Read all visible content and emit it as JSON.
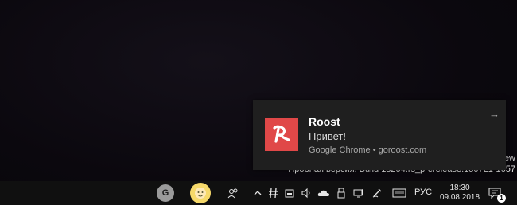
{
  "toast": {
    "title": "Roost",
    "message": "Привет!",
    "source": "Google Chrome • goroost.com",
    "arrow": "→",
    "logo_color": "#e04848"
  },
  "watermark": {
    "line_cut": "ew",
    "line2": "Пробная версия. Build 18204.rs_prerelease.180721-1657"
  },
  "taskbar": {
    "avatar_letter": "G",
    "language": "РУС",
    "time": "18:30",
    "date": "09.08.2018",
    "notification_count": "1",
    "tray_icons": [
      "people-icon",
      "chevron-up-icon",
      "network-hash-icon",
      "battery-icon",
      "volume-icon",
      "onedrive-cloud-icon",
      "usb-icon",
      "windows-ink-icon",
      "pen-icon",
      "keyboard-icon"
    ]
  }
}
